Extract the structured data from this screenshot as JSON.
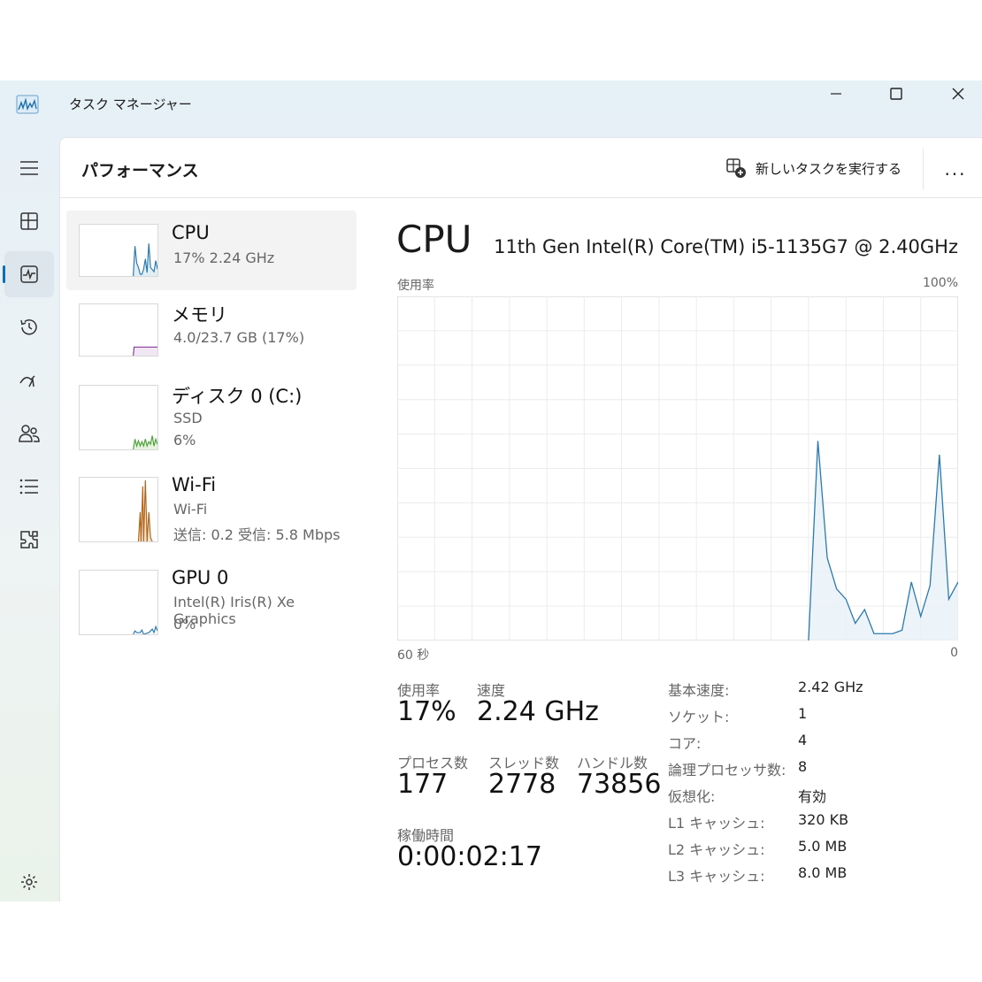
{
  "window": {
    "title": "タスク マネージャー"
  },
  "nav": {
    "items": [
      {
        "icon": "hamburger-icon"
      },
      {
        "icon": "processes-icon"
      },
      {
        "icon": "performance-icon",
        "active": true
      },
      {
        "icon": "app-history-icon"
      },
      {
        "icon": "startup-apps-icon"
      },
      {
        "icon": "users-icon"
      },
      {
        "icon": "details-icon"
      },
      {
        "icon": "services-icon"
      },
      {
        "icon": "settings-icon"
      }
    ]
  },
  "header": {
    "title": "パフォーマンス",
    "new_task_label": "新しいタスクを実行する",
    "more_label": "..."
  },
  "resources": [
    {
      "name": "CPU",
      "sub1": "17%  2.24 GHz",
      "sub2": ""
    },
    {
      "name": "メモリ",
      "sub1": "4.0/23.7 GB (17%)",
      "sub2": ""
    },
    {
      "name": "ディスク 0 (C:)",
      "sub1": "SSD",
      "sub2": "6%"
    },
    {
      "name": "Wi-Fi",
      "sub1": "Wi-Fi",
      "sub2": "送信: 0.2  受信: 5.8 Mbps"
    },
    {
      "name": "GPU 0",
      "sub1": "Intel(R) Iris(R) Xe Graphics",
      "sub2": "0%"
    }
  ],
  "detail": {
    "title": "CPU",
    "model": "11th Gen Intel(R) Core(TM) i5-1135G7 @ 2.40GHz",
    "graph_label": "使用率",
    "graph_max": "100%",
    "graph_time": "60 秒",
    "graph_min": "0",
    "stats": {
      "usage_label": "使用率",
      "usage_value": "17%",
      "speed_label": "速度",
      "speed_value": "2.24 GHz",
      "processes_label": "プロセス数",
      "processes_value": "177",
      "threads_label": "スレッド数",
      "threads_value": "2778",
      "handles_label": "ハンドル数",
      "handles_value": "73856",
      "uptime_label": "稼働時間",
      "uptime_value": "0:00:02:17"
    },
    "properties": [
      {
        "key": "基本速度:",
        "value": "2.42 GHz"
      },
      {
        "key": "ソケット:",
        "value": "1"
      },
      {
        "key": "コア:",
        "value": "4"
      },
      {
        "key": "論理プロセッサ数:",
        "value": "8"
      },
      {
        "key": "仮想化:",
        "value": "有効"
      },
      {
        "key": "L1 キャッシュ:",
        "value": "320 KB"
      },
      {
        "key": "L2 キャッシュ:",
        "value": "5.0 MB"
      },
      {
        "key": "L3 キャッシュ:",
        "value": "8.0 MB"
      }
    ]
  },
  "chart_data": {
    "type": "area",
    "title": "",
    "ylabel": "使用率",
    "xlabel": "60 秒",
    "xlim": [
      60,
      0
    ],
    "ylim": [
      0,
      100
    ],
    "grid": true,
    "color": "#2a7ab0",
    "series": [
      {
        "x": [
          16,
          15,
          14,
          13,
          12,
          11,
          10,
          9,
          8,
          7,
          6,
          5,
          4,
          3,
          2,
          1,
          0
        ],
        "values": [
          0,
          58,
          24,
          15,
          12,
          5,
          9,
          2,
          2,
          2,
          3,
          17,
          7,
          16,
          54,
          12,
          17
        ]
      }
    ]
  }
}
